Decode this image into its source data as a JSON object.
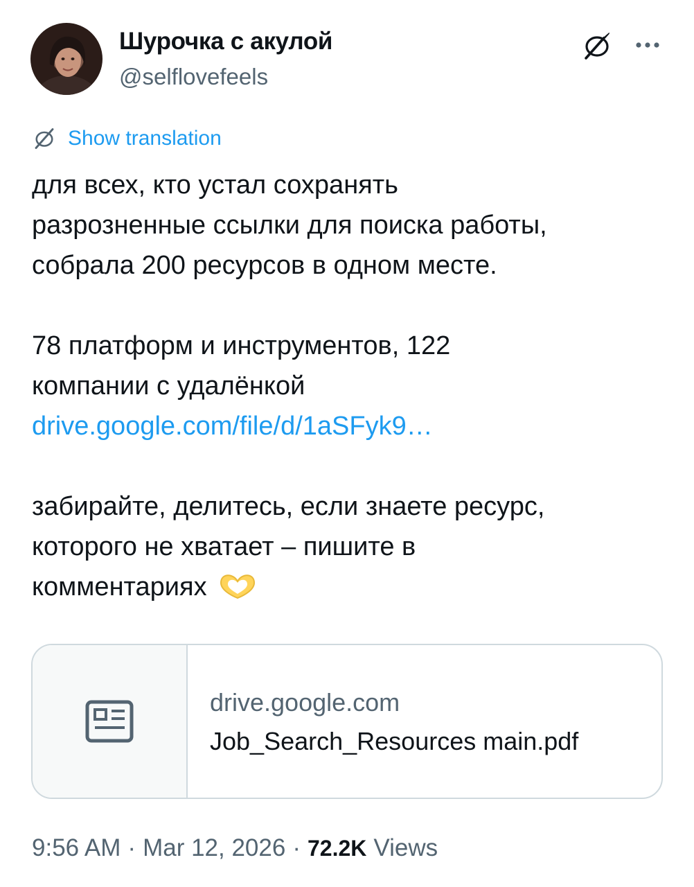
{
  "author": {
    "display_name": "Шурочка с акулой",
    "handle": "@selflovefeels"
  },
  "icons": {
    "avatar": "avatar-photo",
    "grok": "grok-slash-circle-icon",
    "more": "more-horizontal-icon",
    "translate": "grok-slash-circle-icon",
    "card": "document-icon",
    "emoji": "heart-hands-emoji"
  },
  "translation": {
    "label": "Show translation"
  },
  "tweet": {
    "line1": "для всех, кто устал сохранять",
    "line2": "разрозненные ссылки для поиска работы,",
    "line3": "собрала 200 ресурсов в одном месте.",
    "line4": "78 платформ и инструментов, 122",
    "line5": "компании с удалёнкой",
    "link": "drive.google.com/file/d/1aSFyk9…",
    "line6": "забирайте, делитесь, если знаете ресурс,",
    "line7": "которого не хватает – пишите в",
    "line8": "комментариях"
  },
  "card": {
    "domain": "drive.google.com",
    "title": "Job_Search_Resources main.pdf"
  },
  "meta": {
    "time": "9:56 AM",
    "date": "Mar 12, 2026",
    "separator": "·",
    "views_count": "72.2K",
    "views_label": "Views"
  },
  "colors": {
    "accent": "#1d9bf0",
    "secondary_text": "#536471",
    "border": "#cfd9de"
  }
}
